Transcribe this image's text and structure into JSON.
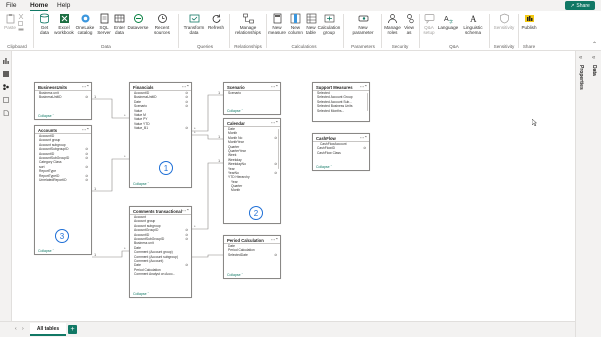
{
  "menu": {
    "file": "File",
    "home": "Home",
    "help": "Help"
  },
  "share": {
    "label": "Share"
  },
  "ribbon": {
    "clipboard": {
      "group": "Clipboard",
      "paste": "Paste"
    },
    "data": {
      "group": "Data",
      "get_data": "Get data",
      "excel": "Excel workbook",
      "onelake": "OneLake catalog",
      "sql": "SQL Server",
      "enter": "Enter data",
      "dataverse": "Dataverse",
      "recent": "Recent sources"
    },
    "queries": {
      "group": "Queries",
      "transform": "Transform data",
      "refresh": "Refresh"
    },
    "relationships": {
      "group": "Relationships",
      "manage": "Manage relationships"
    },
    "calculations": {
      "group": "Calculations",
      "new_measure": "New measure",
      "new_column": "New column",
      "new_table": "New table",
      "calc_group": "Calculation group"
    },
    "parameters": {
      "group": "Parameters",
      "new_param": "New parameter"
    },
    "security": {
      "group": "Security",
      "manage_roles": "Manage roles",
      "view_as": "View as"
    },
    "qa": {
      "group": "Q&A",
      "qa_setup": "Q&A setup",
      "language": "Language",
      "linguistic": "Linguistic schema"
    },
    "sensitivity": {
      "group": "Sensitivity",
      "label": "Sensitivity"
    },
    "share": {
      "group": "Share",
      "publish": "Publish"
    }
  },
  "right_panel": {
    "data": "Data",
    "properties": "Properties"
  },
  "bottom": {
    "tab": "All tables",
    "add": "+"
  },
  "badges": [
    "1",
    "2",
    "3"
  ],
  "collapse_label": "Collapse",
  "tables": {
    "businessunits": {
      "title": "BusinessUnits",
      "fields": [
        "Business unit",
        "BusinessUnitID"
      ]
    },
    "accounts": {
      "title": "Accounts",
      "fields": [
        "AccountID",
        "Account group",
        "Account subgroup",
        "AccountSubgroupID",
        "AccountID",
        "AccountSubGroupID",
        "Category Class",
        "sort",
        "ReportType",
        "ReportTypeID",
        "UnrelatedReportID"
      ]
    },
    "financials": {
      "title": "Financials",
      "fields": [
        "AccountID",
        "BusinessUnitID",
        "Date",
        "Scenario",
        "Value",
        "Value M",
        "Value PY",
        "Value YTD",
        "Value_B1"
      ]
    },
    "scenario": {
      "title": "Scenario",
      "fields": [
        "Scenario"
      ]
    },
    "calendar": {
      "title": "Calendar",
      "fields": [
        "Date",
        "Month",
        "Month No",
        "MonthYear",
        "Quarter",
        "QuarterYear",
        "Week",
        "Weekday",
        "WeekdayNo",
        "Year",
        "YearNo",
        "YTD Hierarchy",
        "Year",
        "Quarter",
        "Month"
      ]
    },
    "support": {
      "title": "Support Measures",
      "fields": [
        "Selected",
        "Selected Account Group",
        "Selected Account Sub...",
        "Selected Business Units",
        "Selected Months..."
      ]
    },
    "cashflow": {
      "title": "CashFlow",
      "fields": [
        "CashFlowAccount",
        "CashFlowID",
        "CashFlow Class"
      ]
    },
    "comments": {
      "title": "Comments transactional",
      "fields": [
        "Account",
        "Account group",
        "Account subgroup",
        "AccountGroupID",
        "AccountID",
        "AccountSubGroupID",
        "Business unit",
        "Date",
        "Comment (Account group)",
        "Comment (Account subgroup)",
        "Comment (Account)",
        "Date",
        "Period Calculation",
        "Comment Analyst on Acco..."
      ]
    },
    "period": {
      "title": "Period Calculation",
      "fields": [
        "Date",
        "Period Calculation",
        "SelectedDate"
      ]
    }
  }
}
